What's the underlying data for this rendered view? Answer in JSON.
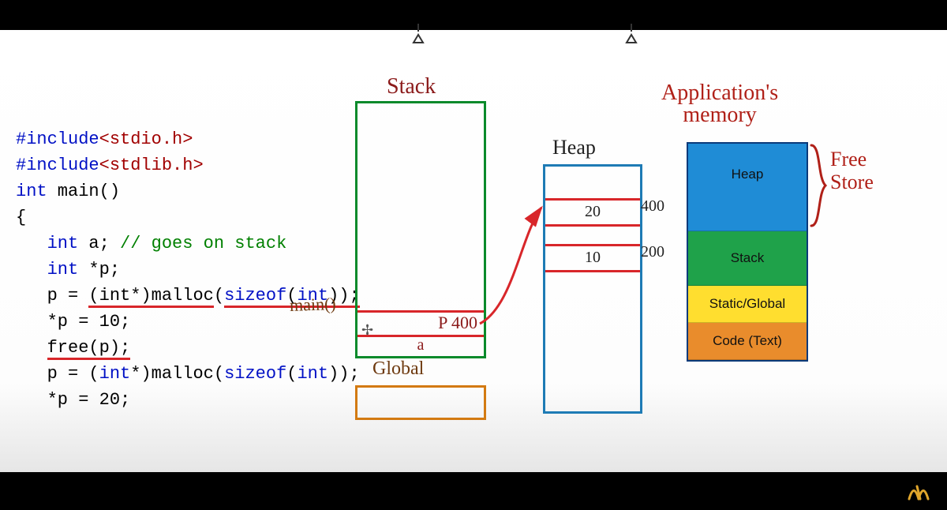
{
  "code": {
    "line1_a": "#include",
    "line1_b": "<stdio.h>",
    "line2_a": "#include",
    "line2_b": "<stdlib.h>",
    "line3_a": "int",
    "line3_b": " main()",
    "line4": "{",
    "line5_a": "   int",
    "line5_b": " a; ",
    "line5_c": "// goes on stack",
    "line6_a": "   int",
    "line6_b": " *p;",
    "line7_a": "   p = ",
    "line7_b": "(int*)malloc",
    "line7_c": "(",
    "line7_d": "sizeof",
    "line7_e": "(",
    "line7_f": "int",
    "line7_g": "));",
    "line8": "   *p = 10;",
    "line9_a": "   ",
    "line9_b": "free(p);",
    "line10_a": "   p = (",
    "line10_b": "int",
    "line10_c": "*)malloc(",
    "line10_d": "sizeof",
    "line10_e": "(",
    "line10_f": "int",
    "line10_g": "));",
    "line11": "   *p = 20;"
  },
  "labels": {
    "stack": "Stack",
    "main": "main()",
    "global": "Global",
    "heap": "Heap",
    "app_title_1": "Application's",
    "app_title_2": "memory",
    "free1": "Free",
    "free2": "Store",
    "p_cell": "P 400",
    "a_cell": "a"
  },
  "heap": {
    "cell1_val": "20",
    "cell1_addr": "400",
    "cell2_val": "10",
    "cell2_addr": "200"
  },
  "appmem": {
    "heap": "Heap",
    "stack": "Stack",
    "static": "Static/Global",
    "code": "Code (Text)"
  }
}
